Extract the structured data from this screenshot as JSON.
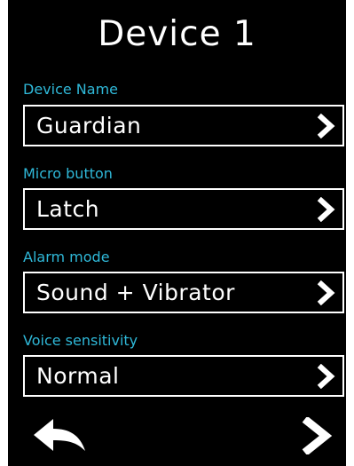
{
  "screen": {
    "title": "Device 1"
  },
  "fields": [
    {
      "label": "Device Name",
      "value": "Guardian",
      "icon": "chevron-right-icon"
    },
    {
      "label": "Micro button",
      "value": "Latch",
      "icon": "chevron-right-icon"
    },
    {
      "label": "Alarm mode",
      "value": "Sound + Vibrator",
      "icon": "chevron-right-icon"
    },
    {
      "label": "Voice sensitivity",
      "value": "Normal",
      "icon": "chevron-right-icon"
    }
  ],
  "nav": {
    "back_icon": "back-arrow-icon",
    "next_icon": "chevron-right-icon"
  },
  "colors": {
    "background": "#000000",
    "label": "#2fb8d8",
    "text": "#ffffff",
    "frame": "#ffffff"
  }
}
